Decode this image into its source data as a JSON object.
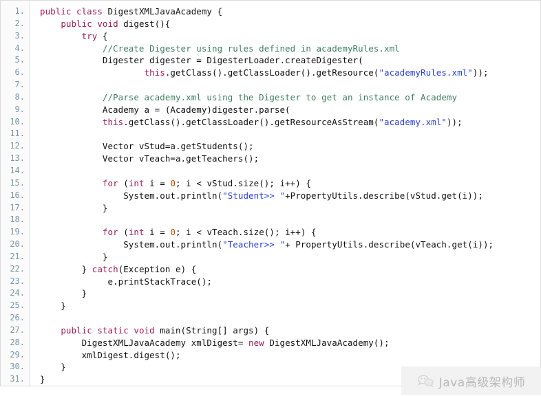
{
  "editor": {
    "language": "java",
    "first_line_number": 1,
    "last_line_number": 31,
    "total_lines": 31,
    "colors": {
      "background": "#ffffff",
      "gutter_background": "#fbfbfb",
      "gutter_border": "#d9d9d9",
      "line_number": "#7a96a8",
      "plain_text": "#111111",
      "keyword": "#9b1b58",
      "string": "#2b3fd0",
      "comment": "#3f7f5f",
      "number": "#b35000"
    },
    "line_numbers": [
      "1.",
      "2.",
      "3.",
      "4.",
      "5.",
      "6.",
      "7.",
      "8.",
      "9.",
      "10.",
      "11.",
      "12.",
      "13.",
      "14.",
      "15.",
      "16.",
      "17.",
      "18.",
      "19.",
      "20.",
      "21.",
      "22.",
      "23.",
      "24.",
      "25.",
      "26.",
      "27.",
      "28.",
      "29.",
      "30.",
      "31."
    ],
    "lines": [
      [
        {
          "t": "kw",
          "v": "public class "
        },
        {
          "t": "pln",
          "v": "DigestXMLJavaAcademy {"
        }
      ],
      [
        {
          "t": "pln",
          "v": "    "
        },
        {
          "t": "kw",
          "v": "public void "
        },
        {
          "t": "pln",
          "v": "digest(){"
        }
      ],
      [
        {
          "t": "pln",
          "v": "        "
        },
        {
          "t": "kw",
          "v": "try"
        },
        {
          "t": "pln",
          "v": " {"
        }
      ],
      [
        {
          "t": "cmt",
          "v": "            //Create Digester using rules defined in academyRules.xml"
        }
      ],
      [
        {
          "t": "pln",
          "v": "            Digester digester = DigesterLoader.createDigester("
        }
      ],
      [
        {
          "t": "pln",
          "v": "                    "
        },
        {
          "t": "kw",
          "v": "this"
        },
        {
          "t": "pln",
          "v": ".getClass().getClassLoader().getResource("
        },
        {
          "t": "str",
          "v": "\"academyRules.xml\""
        },
        {
          "t": "pln",
          "v": "));"
        }
      ],
      [
        {
          "t": "pln",
          "v": ""
        }
      ],
      [
        {
          "t": "cmt",
          "v": "            //Parse academy.xml using the Digester to get an instance of Academy"
        }
      ],
      [
        {
          "t": "pln",
          "v": "            Academy a = (Academy)digester.parse("
        }
      ],
      [
        {
          "t": "pln",
          "v": "            "
        },
        {
          "t": "kw",
          "v": "this"
        },
        {
          "t": "pln",
          "v": ".getClass().getClassLoader().getResourceAsStream("
        },
        {
          "t": "str",
          "v": "\"academy.xml\""
        },
        {
          "t": "pln",
          "v": "));"
        }
      ],
      [
        {
          "t": "pln",
          "v": ""
        }
      ],
      [
        {
          "t": "pln",
          "v": "            Vector vStud=a.getStudents();"
        }
      ],
      [
        {
          "t": "pln",
          "v": "            Vector vTeach=a.getTeachers();"
        }
      ],
      [
        {
          "t": "pln",
          "v": ""
        }
      ],
      [
        {
          "t": "pln",
          "v": "            "
        },
        {
          "t": "kw",
          "v": "for"
        },
        {
          "t": "pln",
          "v": " ("
        },
        {
          "t": "kw",
          "v": "int"
        },
        {
          "t": "pln",
          "v": " i = "
        },
        {
          "t": "num",
          "v": "0"
        },
        {
          "t": "pln",
          "v": "; i < vStud.size(); i++) {"
        }
      ],
      [
        {
          "t": "pln",
          "v": "                System.out.println("
        },
        {
          "t": "str",
          "v": "\"Student>> \""
        },
        {
          "t": "pln",
          "v": "+PropertyUtils.describe(vStud.get(i));"
        }
      ],
      [
        {
          "t": "pln",
          "v": "            }"
        }
      ],
      [
        {
          "t": "pln",
          "v": ""
        }
      ],
      [
        {
          "t": "pln",
          "v": "            "
        },
        {
          "t": "kw",
          "v": "for"
        },
        {
          "t": "pln",
          "v": " ("
        },
        {
          "t": "kw",
          "v": "int"
        },
        {
          "t": "pln",
          "v": " i = "
        },
        {
          "t": "num",
          "v": "0"
        },
        {
          "t": "pln",
          "v": "; i < vTeach.size(); i++) {"
        }
      ],
      [
        {
          "t": "pln",
          "v": "                System.out.println("
        },
        {
          "t": "str",
          "v": "\"Teacher>> \""
        },
        {
          "t": "pln",
          "v": "+ PropertyUtils.describe(vTeach.get(i));"
        }
      ],
      [
        {
          "t": "pln",
          "v": "            }"
        }
      ],
      [
        {
          "t": "pln",
          "v": "        } "
        },
        {
          "t": "kw",
          "v": "catch"
        },
        {
          "t": "pln",
          "v": "(Exception e) {"
        }
      ],
      [
        {
          "t": "pln",
          "v": "             e.printStackTrace();"
        }
      ],
      [
        {
          "t": "pln",
          "v": "        }"
        }
      ],
      [
        {
          "t": "pln",
          "v": "    }"
        }
      ],
      [
        {
          "t": "pln",
          "v": ""
        }
      ],
      [
        {
          "t": "pln",
          "v": "    "
        },
        {
          "t": "kw",
          "v": "public static void "
        },
        {
          "t": "pln",
          "v": "main(String[] args) {"
        }
      ],
      [
        {
          "t": "pln",
          "v": "        DigestXMLJavaAcademy xmlDigest= "
        },
        {
          "t": "kw",
          "v": "new"
        },
        {
          "t": "pln",
          "v": " DigestXMLJavaAcademy();"
        }
      ],
      [
        {
          "t": "pln",
          "v": "        xmlDigest.digest();"
        }
      ],
      [
        {
          "t": "pln",
          "v": "    }"
        }
      ],
      [
        {
          "t": "pln",
          "v": "}"
        }
      ]
    ]
  },
  "watermark": {
    "text": "Java高级架构师",
    "icon": "wechat-logo-icon",
    "background": "#f2f2f2",
    "text_color": "#b9b9b9"
  }
}
